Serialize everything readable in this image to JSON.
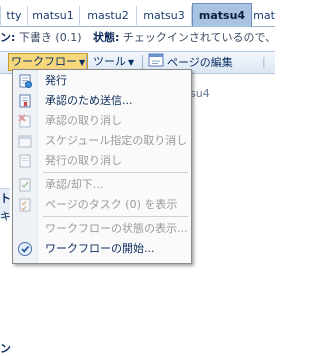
{
  "tabs": [
    {
      "label": "tty"
    },
    {
      "label": "matsu1"
    },
    {
      "label": "mastu2"
    },
    {
      "label": "matsu3"
    },
    {
      "label": "matsu4"
    },
    {
      "label": "mat"
    }
  ],
  "status_line": {
    "version_label": "ン:",
    "version_value": "下書き (0.1)",
    "status_label": "状態:",
    "status_value": "チェックインされているので、権限の"
  },
  "toolbar": {
    "workflow_label": "ワークフロー",
    "tools_label": "ツール",
    "edit_page_label": "ページの編集",
    "overflow_label": "|"
  },
  "background": {
    "tsu4_text": "su4",
    "left_letters": [
      "ト",
      "キ",
      "ン"
    ]
  },
  "menu": {
    "items": [
      {
        "label": "発行",
        "icon": "publish-icon",
        "enabled": true
      },
      {
        "label": "承認のため送信...",
        "icon": "submit-approval-icon",
        "enabled": true
      },
      {
        "label": "承認の取り消し",
        "icon": "cancel-approval-icon",
        "enabled": false
      },
      {
        "label": "スケジュール指定の取り消し",
        "icon": "calendar-cancel-icon",
        "enabled": false
      },
      {
        "label": "発行の取り消し",
        "icon": "unpublish-icon",
        "enabled": false
      },
      {
        "label": "承認/却下...",
        "icon": "approve-reject-icon",
        "enabled": false
      },
      {
        "label": "ページのタスク (0) を表示",
        "icon": "tasks-icon",
        "enabled": false
      },
      {
        "label": "ワークフローの状態の表示...",
        "icon": "workflow-status-icon",
        "enabled": false
      },
      {
        "label": "ワークフローの開始...",
        "icon": "workflow-start-icon",
        "enabled": true
      }
    ]
  },
  "colors": {
    "active_tab": "#a9c3e2",
    "open_button": "#f6d77b",
    "menu_text": "#0b2a5a",
    "disabled_text": "#9a9a9a"
  }
}
